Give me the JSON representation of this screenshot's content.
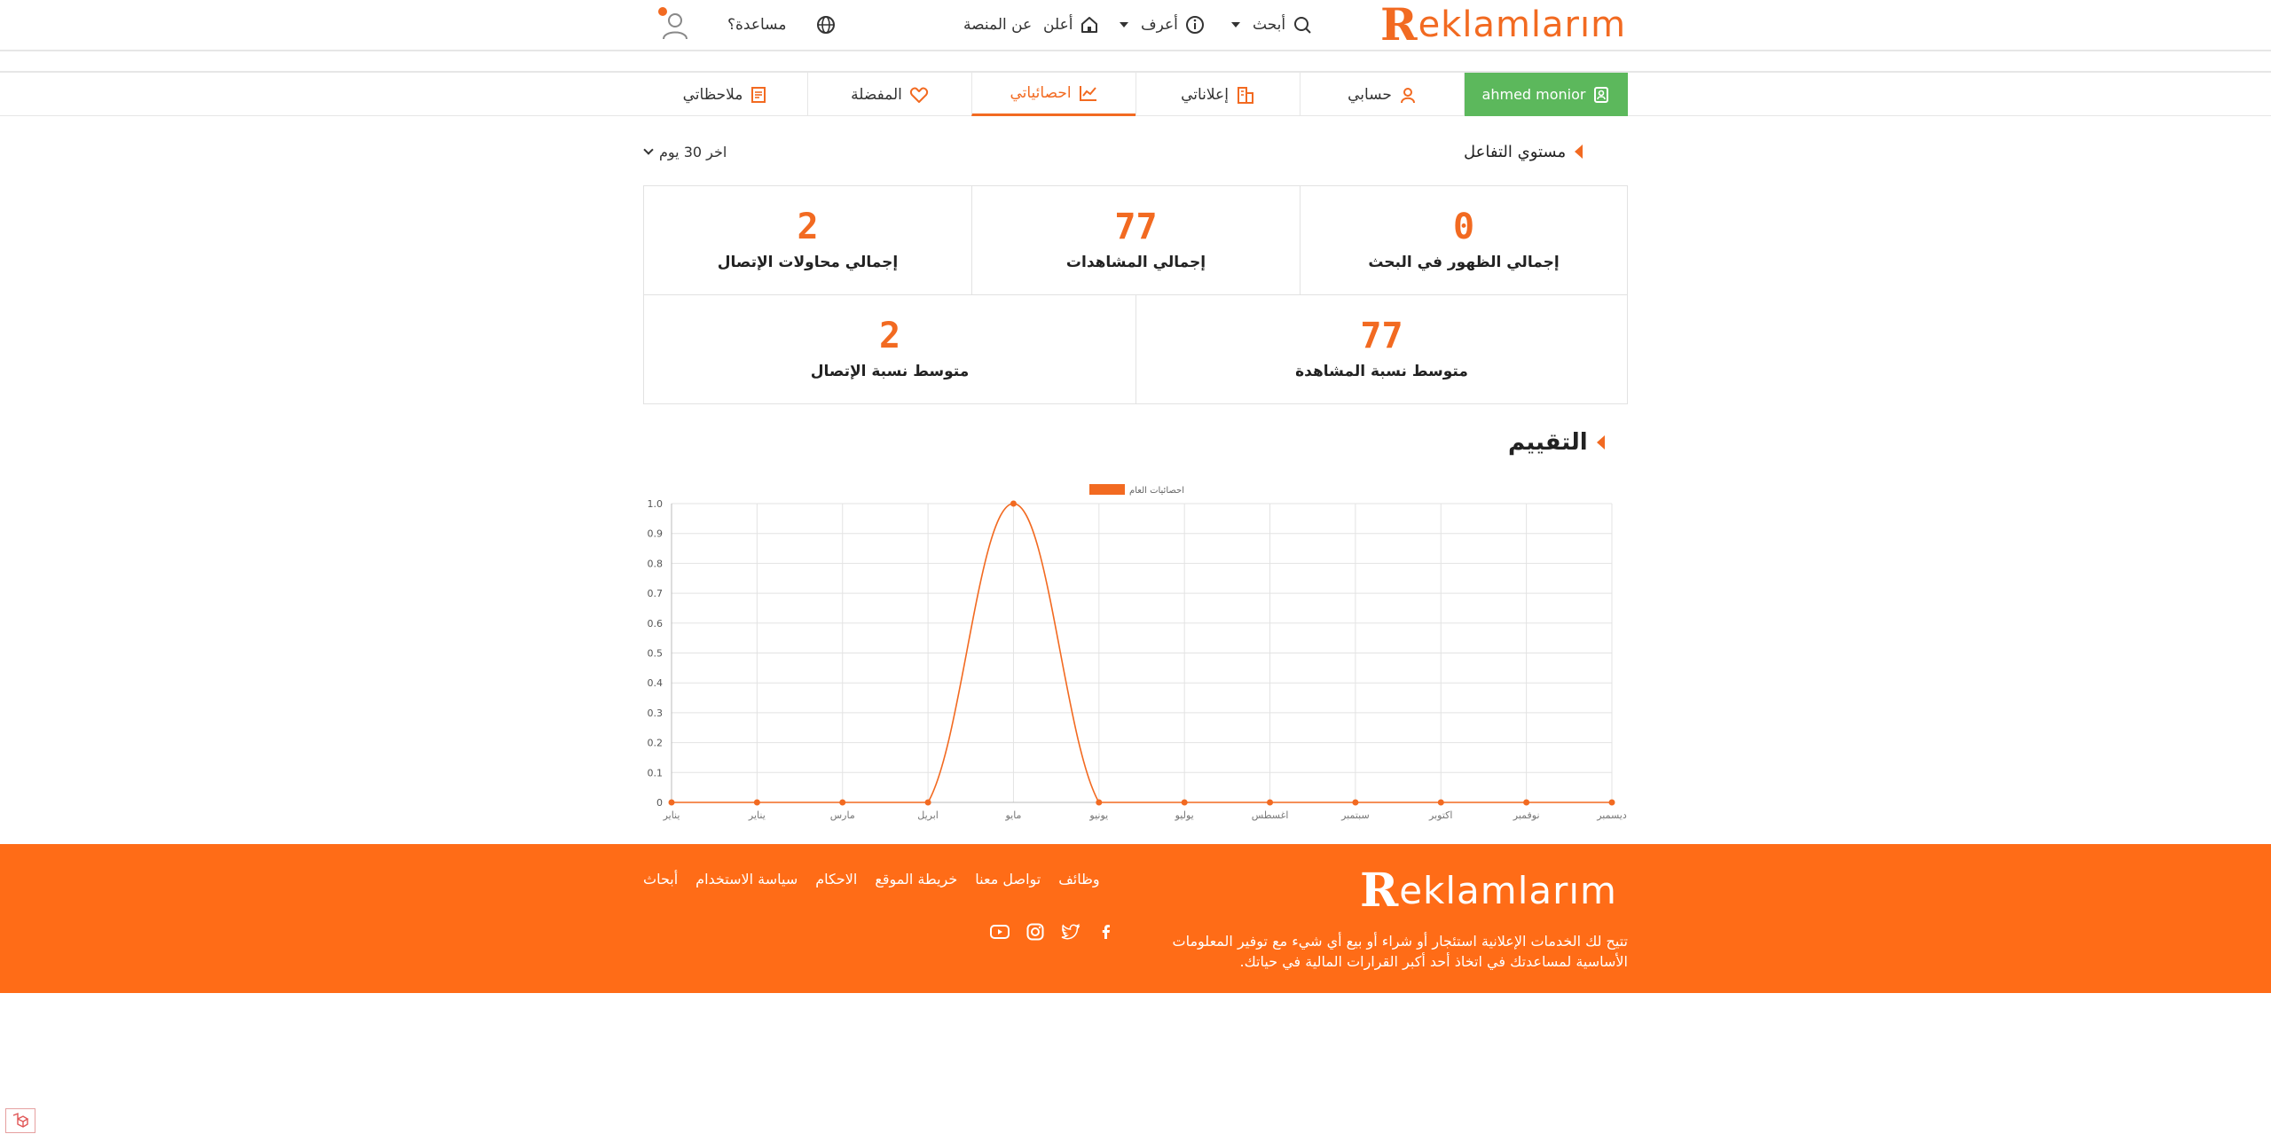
{
  "header": {
    "logo_first": "R",
    "logo_rest": "eklamlarım",
    "nav": {
      "search": "أبحث",
      "learn": "أعرف",
      "advertise": "أعلن",
      "about": "عن المنصة",
      "help": "مساعدة؟"
    }
  },
  "tabs": [
    {
      "label": "ahmed monior",
      "icon": "document-user-icon"
    },
    {
      "label": "حسابي",
      "icon": "user-icon"
    },
    {
      "label": "إعلاناتي",
      "icon": "building-icon"
    },
    {
      "label": "احصائياتي",
      "icon": "line-chart-icon"
    },
    {
      "label": "المفضلة",
      "icon": "heart-icon"
    },
    {
      "label": "ملاحظاتي",
      "icon": "notes-icon"
    }
  ],
  "engagement": {
    "title": "مستوي التفاعل",
    "range": "اخر 30 يوم",
    "cards": [
      {
        "value": "0",
        "label": "إجمالي الظهور في البحث"
      },
      {
        "value": "77",
        "label": "إجمالي المشاهدات"
      },
      {
        "value": "2",
        "label": "إجمالي محاولات الإتصال"
      },
      {
        "value": "77",
        "label": "متوسط نسبة المشاهدة"
      },
      {
        "value": "2",
        "label": "متوسط نسبة الإتصال"
      }
    ]
  },
  "rating": {
    "title": "التقييم"
  },
  "colors": {
    "accent": "#f26a21",
    "footer": "#ff6c17",
    "green": "#5cb85c"
  },
  "chart_data": {
    "type": "line",
    "legend": "احصائيات العام",
    "legend_position": "top-center",
    "grid": true,
    "categories": [
      "يناير",
      "يناير",
      "مارس",
      "ابريل",
      "مايو",
      "يونيو",
      "يوليو",
      "اغسطس",
      "سبتمبر",
      "اكتوبر",
      "نوفمبر",
      "ديسمبر"
    ],
    "series": [
      {
        "name": "احصائيات العام",
        "values": [
          0,
          0,
          0,
          0,
          1,
          0,
          0,
          0,
          0,
          0,
          0,
          0
        ]
      }
    ],
    "y_ticks": [
      "0",
      "0.1",
      "0.2",
      "0.3",
      "0.4",
      "0.5",
      "0.6",
      "0.7",
      "0.8",
      "0.9",
      "1.0"
    ],
    "ylim": [
      0,
      1
    ]
  },
  "footer": {
    "logo_first": "R",
    "logo_rest": "eklamlarım",
    "description": "تتيح لك الخدمات الإعلانية استئجار أو شراء أو بيع أي شيء مع توفير المعلومات الأساسية لمساعدتك في اتخاذ أحد أكبر القرارات المالية في حياتك.",
    "links": [
      "وظائف",
      "تواصل معنا",
      "خريطة الموقع",
      "الاحكام",
      "سياسة الاستخدام",
      "أبحاث"
    ],
    "social": [
      "facebook-icon",
      "twitter-icon",
      "instagram-icon",
      "youtube-icon"
    ]
  }
}
